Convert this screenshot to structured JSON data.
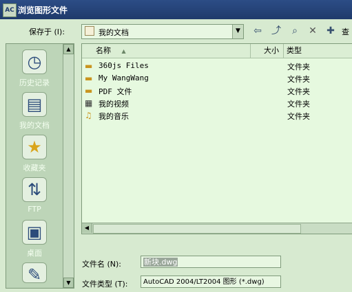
{
  "window": {
    "title": "浏览图形文件"
  },
  "save_in": {
    "label": "保存于 (I):",
    "value": "我的文档"
  },
  "toolbar": [
    "back-arrow-icon",
    "up-folder-icon",
    "search-icon",
    "delete-icon",
    "new-folder-icon"
  ],
  "toolbar_view_label": "查",
  "places": [
    {
      "label": "历史记录",
      "icon": "history-icon"
    },
    {
      "label": "我的文档",
      "icon": "documents-icon"
    },
    {
      "label": "收藏夹",
      "icon": "favorites-icon"
    },
    {
      "label": "FTP",
      "icon": "ftp-icon"
    },
    {
      "label": "桌面",
      "icon": "desktop-icon"
    }
  ],
  "columns": {
    "name": "名称",
    "size": "大小",
    "type": "类型"
  },
  "files": [
    {
      "name": "360js Files",
      "type": "文件夹",
      "icon": "folder-icon"
    },
    {
      "name": "My WangWang",
      "type": "文件夹",
      "icon": "folder-icon"
    },
    {
      "name": "PDF 文件",
      "type": "文件夹",
      "icon": "folder-icon"
    },
    {
      "name": "我的视频",
      "type": "文件夹",
      "icon": "video-folder-icon"
    },
    {
      "name": "我的音乐",
      "type": "文件夹",
      "icon": "music-folder-icon"
    }
  ],
  "filename": {
    "label": "文件名 (N):",
    "value": "新块.dwg"
  },
  "filetype": {
    "label": "文件类型 (T):",
    "value": "AutoCAD 2004/LT2004 图形 (*.dwg)"
  }
}
